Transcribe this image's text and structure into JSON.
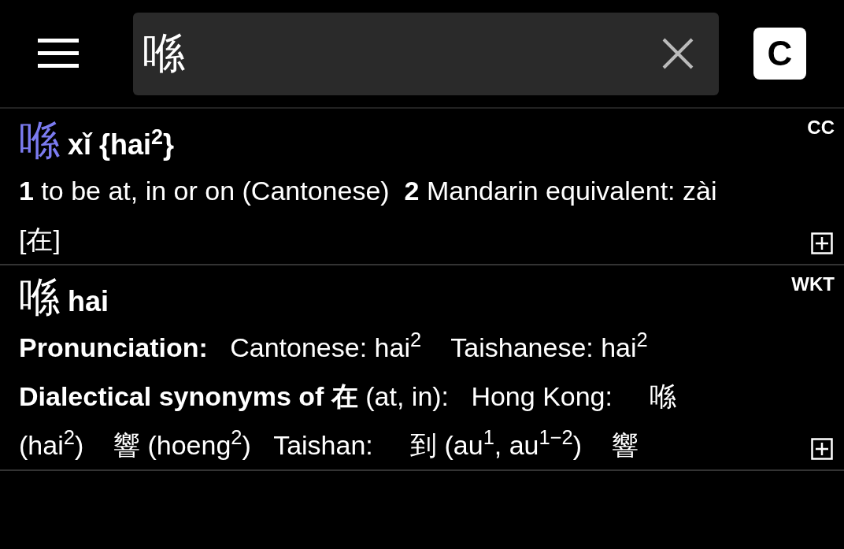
{
  "search": {
    "value": "喺"
  },
  "mode_button": {
    "label": "C"
  },
  "entries": [
    {
      "headword": "喺",
      "color": "#7b7bf0",
      "reading": "xǐ {hai$^{2}$}",
      "source": "CC",
      "paragraphs": [
        "**1** to be at, in or on (Cantonese)  **2** Mandarin equivalent: zài [在]"
      ]
    },
    {
      "headword": "喺",
      "color": "#ffffff",
      "reading": "hai",
      "source": "WKT",
      "paragraphs": [
        "**Pronunciation:**   Cantonese: hai$^{2}$    Taishanese: hai$^{2}$",
        "**Dialectical synonyms of 在** (at, in):   Hong Kong:     喺 (hai$^{2}$)    響 (hoeng$^{2}$)   Taishan:     到 (au$^{1}$, au$^{1−2}$)    響"
      ]
    }
  ]
}
